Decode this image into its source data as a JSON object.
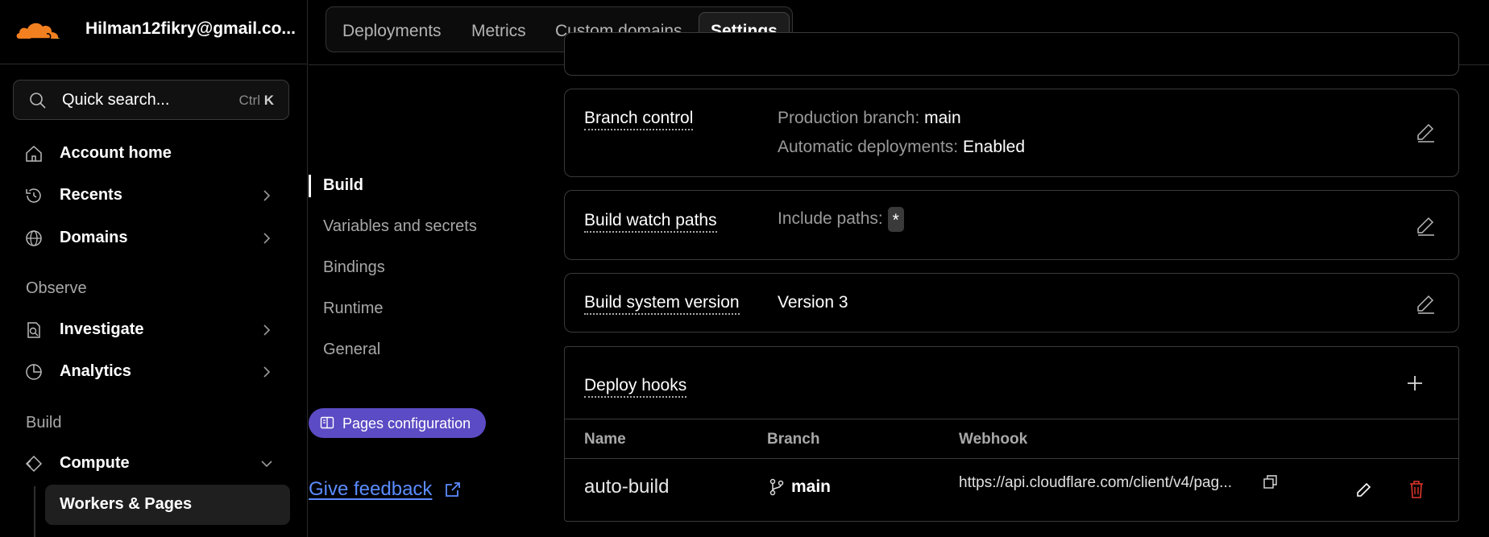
{
  "sidebar": {
    "account": "Hilman12fikry@gmail.co...",
    "search": {
      "label": "Quick search...",
      "shortcut_mod": "Ctrl",
      "shortcut_key": "K"
    },
    "items": [
      {
        "label": "Account home",
        "icon": "home-icon"
      },
      {
        "label": "Recents",
        "icon": "history-icon"
      },
      {
        "label": "Domains",
        "icon": "globe-icon"
      },
      {
        "label": "Investigate",
        "icon": "investigate-icon"
      },
      {
        "label": "Analytics",
        "icon": "analytics-icon"
      },
      {
        "label": "Compute",
        "icon": "compute-icon"
      },
      {
        "label": "Workers & Pages"
      }
    ],
    "sections": {
      "observe": "Observe",
      "build": "Build"
    }
  },
  "tabs": [
    "Deployments",
    "Metrics",
    "Custom domains",
    "Settings"
  ],
  "settings_nav": {
    "items": [
      "Build",
      "Variables and secrets",
      "Bindings",
      "Runtime",
      "General"
    ],
    "pages_config": "Pages configuration",
    "feedback": "Give feedback"
  },
  "branch_control": {
    "title": "Branch control",
    "prod_label": "Production branch:",
    "prod_value": "main",
    "auto_label": "Automatic deployments:",
    "auto_value": "Enabled"
  },
  "watch_paths": {
    "title": "Build watch paths",
    "label": "Include paths:",
    "value": "*"
  },
  "system_version": {
    "title": "Build system version",
    "value": "Version 3"
  },
  "deploy_hooks": {
    "title": "Deploy hooks",
    "columns": [
      "Name",
      "Branch",
      "Webhook"
    ],
    "rows": [
      {
        "name": "auto-build",
        "branch": "main",
        "webhook": "https://api.cloudflare.com/client/v4/pag..."
      }
    ]
  },
  "colors": {
    "accent": "#5b4bc4",
    "link": "#5b8cff",
    "danger": "#e0362c",
    "brand": "#f38020"
  }
}
